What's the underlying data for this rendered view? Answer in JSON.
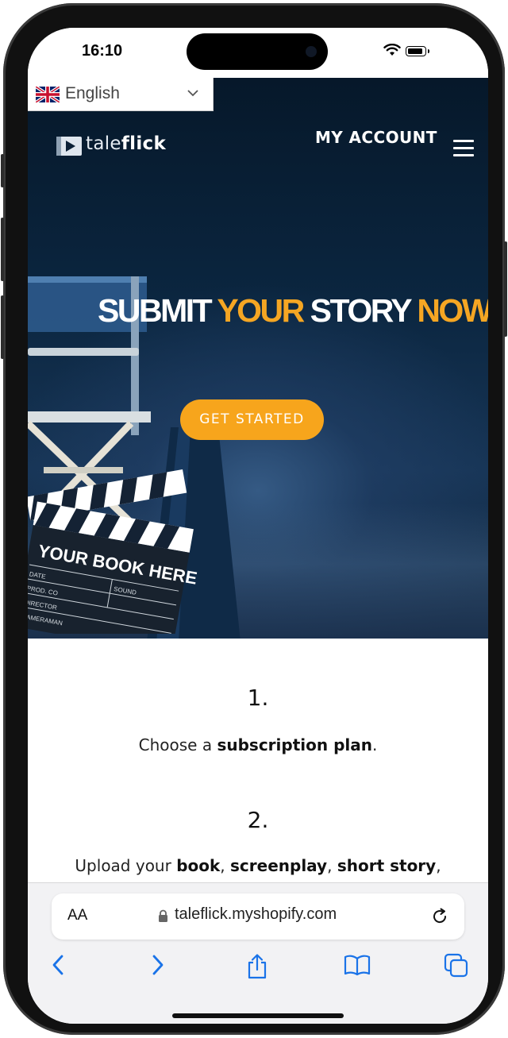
{
  "status_bar": {
    "time": "16:10"
  },
  "language": {
    "selected": "English",
    "flag": "uk-flag-icon"
  },
  "header": {
    "logo_prefix": "tale",
    "logo_suffix": "flick",
    "account_label": "MY ACCOUNT",
    "menu_icon": "hamburger-icon"
  },
  "hero": {
    "headline_parts": [
      "SUBMIT ",
      "YOUR ",
      "STORY ",
      "NOW"
    ],
    "cta_label": "GET STARTED",
    "slate_text": "YOUR BOOK HERE",
    "slate_fields": [
      "DATE",
      "PROD. CO",
      "DIRECTOR",
      "CAMERAMAN",
      "SOUND"
    ],
    "accent_color": "#f5a623"
  },
  "steps": [
    {
      "num": "1.",
      "pre": "Choose a ",
      "bold": "subscription plan",
      "post": "."
    },
    {
      "num": "2.",
      "pre": "Upload your ",
      "bold1": "book",
      "sep1": ", ",
      "bold2": "screenplay",
      "sep2": ", ",
      "bold3": "short story",
      "post": ","
    }
  ],
  "browser": {
    "aa_label": "AA",
    "url": "taleflick.myshopify.com",
    "icons": [
      "back-icon",
      "forward-icon",
      "share-icon",
      "bookmarks-icon",
      "tabs-icon"
    ]
  }
}
